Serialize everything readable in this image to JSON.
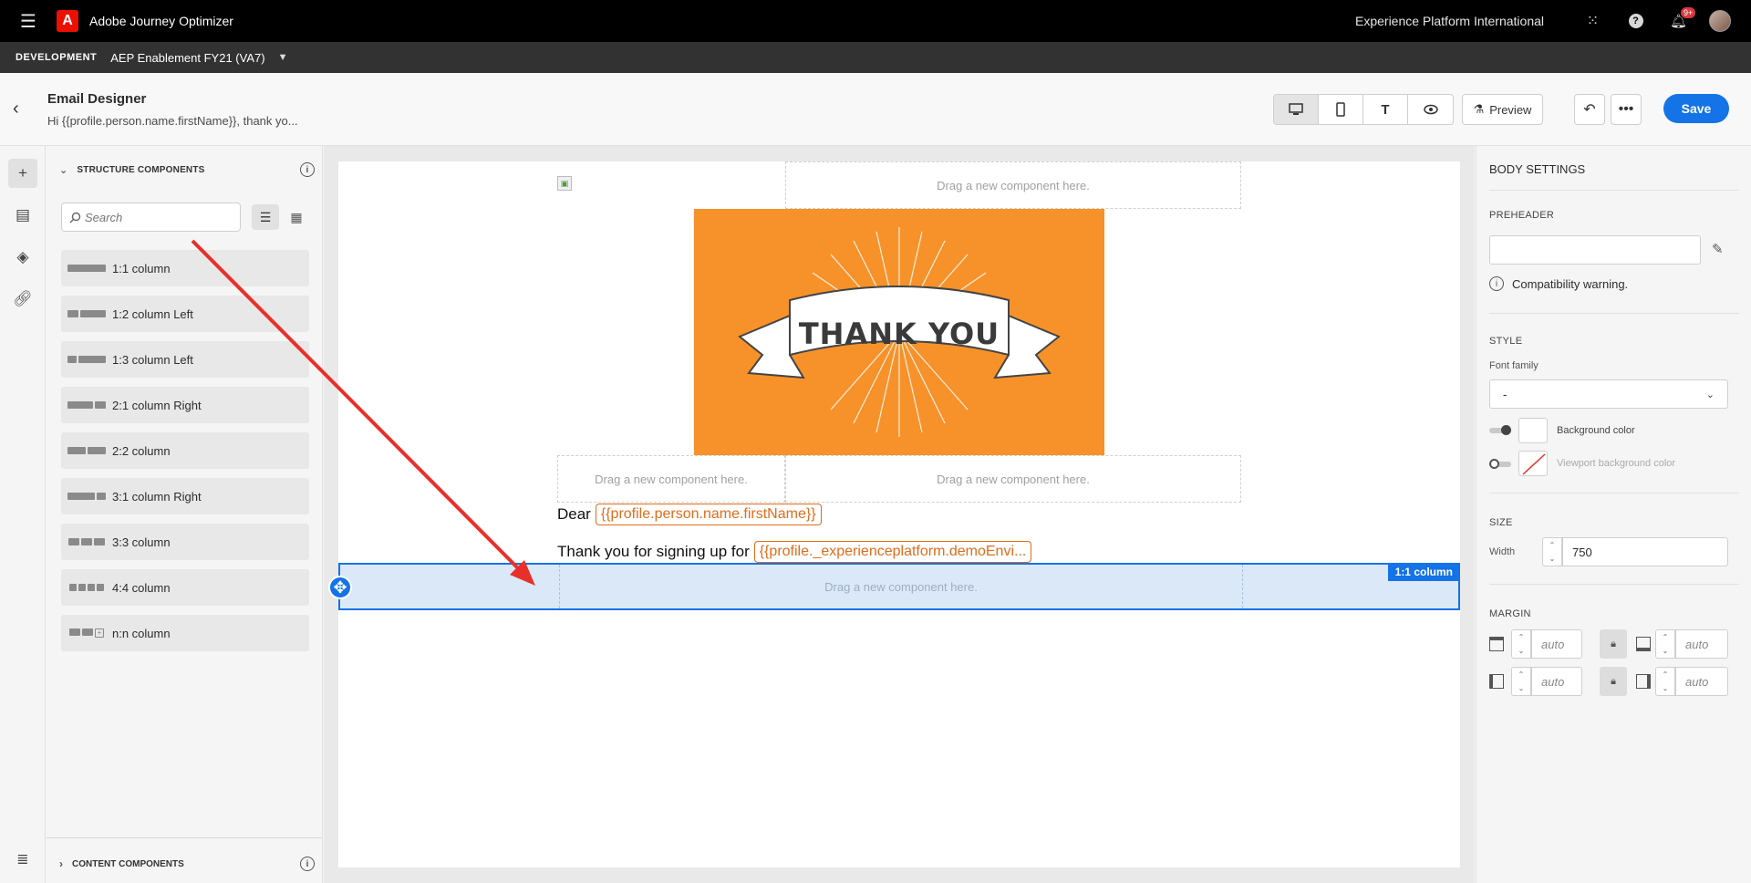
{
  "topbar": {
    "app_title": "Adobe Journey Optimizer",
    "org_name": "Experience Platform International",
    "notification_count": "9+"
  },
  "sandbox": {
    "env_label": "DEVELOPMENT",
    "name": "AEP Enablement FY21 (VA7)"
  },
  "header": {
    "title": "Email Designer",
    "subtitle": "Hi {{profile.person.name.firstName}}, thank yo...",
    "preview_label": "Preview",
    "save_label": "Save"
  },
  "left_panel": {
    "structure_heading": "STRUCTURE COMPONENTS",
    "search_placeholder": "Search",
    "components": [
      {
        "label": "1:1 column"
      },
      {
        "label": "1:2 column Left"
      },
      {
        "label": "1:3 column Left"
      },
      {
        "label": "2:1 column Right"
      },
      {
        "label": "2:2 column"
      },
      {
        "label": "3:1 column Right"
      },
      {
        "label": "3:3 column"
      },
      {
        "label": "4:4 column"
      },
      {
        "label": "n:n column"
      }
    ],
    "content_heading": "CONTENT COMPONENTS"
  },
  "canvas": {
    "drop_placeholder": "Drag a new component here.",
    "thank_you_text": "THANK YOU",
    "dear_text": "Dear",
    "firstname_token": "{{profile.person.name.firstName}}",
    "signup_text": "Thank you for signing up for",
    "demo_token": "{{profile._experienceplatform.demoEnvi...",
    "selected_row_tag": "1:1 column"
  },
  "right_panel": {
    "title": "BODY SETTINGS",
    "preheader_label": "PREHEADER",
    "preheader_value": "",
    "compat_warning": "Compatibility warning.",
    "style_label": "STYLE",
    "font_family_label": "Font family",
    "font_family_value": "-",
    "background_color_label": "Background color",
    "viewport_bg_label": "Viewport background color",
    "size_label": "SIZE",
    "width_label": "Width",
    "width_value": "750",
    "margin_label": "MARGIN",
    "margin_placeholder": "auto"
  },
  "colors": {
    "accent": "#1473e6",
    "brand_red": "#eb1000",
    "token_orange": "#e06c1a",
    "image_orange": "#f7922a"
  }
}
